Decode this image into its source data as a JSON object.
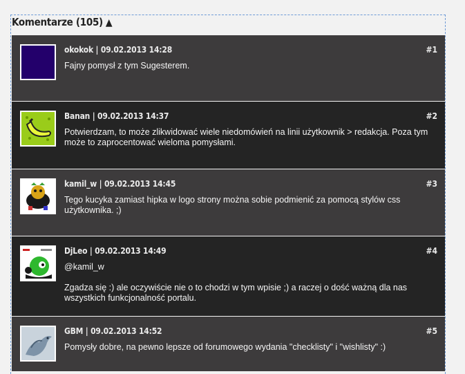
{
  "header": {
    "title": "Komentarze (105)",
    "toggle_icon": "▲"
  },
  "comments": [
    {
      "author": "okokok",
      "date": "09.02.2013 14:28",
      "number": "#1",
      "paragraphs": [
        "Fajny pomysł z tym Sugesterem."
      ]
    },
    {
      "author": "Banan",
      "date": "09.02.2013 14:37",
      "number": "#2",
      "paragraphs": [
        "Potwierdzam, to może zlikwidować wiele niedomówień na linii użytkownik > redakcja. Poza tym może to zaprocentować wieloma pomysłami."
      ]
    },
    {
      "author": "kamil_w",
      "date": "09.02.2013 14:45",
      "number": "#3",
      "paragraphs": [
        "Tego kucyka zamiast hipka w logo strony można sobie podmienić za pomocą stylów css użytkownika. ;)"
      ]
    },
    {
      "author": "DjLeo",
      "date": "09.02.2013 14:49",
      "number": "#4",
      "paragraphs": [
        "@kamil_w",
        "Zgadza się :) ale oczywiście nie o to chodzi w tym wpisie ;) a raczej o dość ważną dla nas wszystkich funkcjonalność portalu."
      ]
    },
    {
      "author": "GBM",
      "date": "09.02.2013 14:52",
      "number": "#5",
      "paragraphs": [
        "Pomysły dobre, na pewno lepsze od forumowego wydania \"checklisty\" i \"wishlisty\" :)"
      ]
    }
  ]
}
